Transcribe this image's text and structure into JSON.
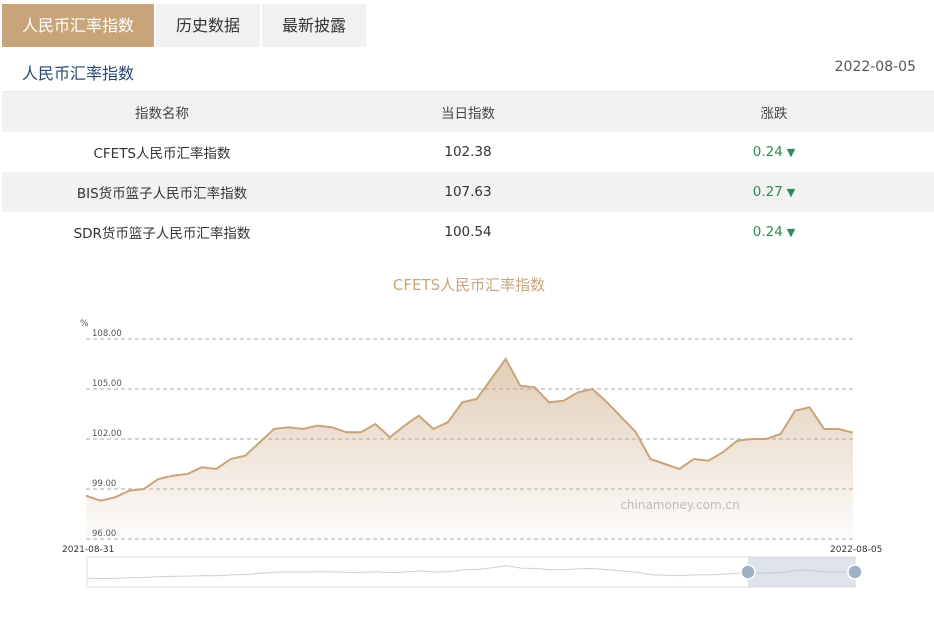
{
  "tabs": [
    "人民币汇率指数",
    "历史数据",
    "最新披露"
  ],
  "section_title": "人民币汇率指数",
  "date": "2022-08-05",
  "table": {
    "headers": [
      "指数名称",
      "当日指数",
      "涨跌"
    ],
    "rows": [
      {
        "name": "CFETS人民币汇率指数",
        "value": "102.38",
        "change": "0.24",
        "direction": "down"
      },
      {
        "name": "BIS货币篮子人民币汇率指数",
        "value": "107.63",
        "change": "0.27",
        "direction": "down"
      },
      {
        "name": "SDR货币篮子人民币汇率指数",
        "value": "100.54",
        "change": "0.24",
        "direction": "down"
      }
    ]
  },
  "colors": {
    "accent": "#c9a47a",
    "down": "#2e8b57",
    "line": "#c9a47a"
  },
  "chart_data": {
    "type": "area",
    "title": "CFETS人民币汇率指数",
    "unit": "%",
    "yticks": [
      "108.00",
      "105.00",
      "102.00",
      "99.00",
      "96.00"
    ],
    "ylim": [
      96,
      108
    ],
    "x_start_label": "2021-08-31",
    "x_end_label": "2022-08-05",
    "watermark": "chinamoney.com.cn",
    "series": [
      {
        "values": [
          98.6,
          98.3,
          98.5,
          98.9,
          99.0,
          99.6,
          99.8,
          99.9,
          100.3,
          100.2,
          100.8,
          101.0,
          101.8,
          102.6,
          102.7,
          102.6,
          102.8,
          102.7,
          102.4,
          102.4,
          102.9,
          102.1,
          102.8,
          103.4,
          102.6,
          103.0,
          104.2,
          104.4,
          105.6,
          106.8,
          105.2,
          105.1,
          104.2,
          104.3,
          104.8,
          105.0,
          104.2,
          103.3,
          102.4,
          100.8,
          100.5,
          100.2,
          100.8,
          100.7,
          101.2,
          101.9,
          102.0,
          102.0,
          102.3,
          103.7,
          103.9,
          102.6,
          102.6,
          102.38
        ]
      }
    ]
  }
}
